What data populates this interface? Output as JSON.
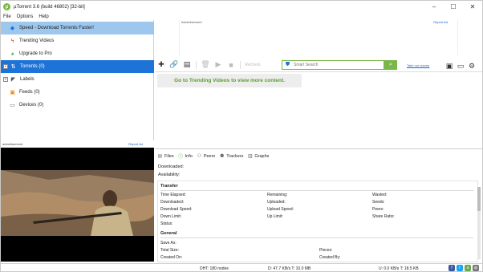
{
  "window": {
    "title": "µTorrent 3.6  (build 46802) [32-bit]",
    "controls": [
      "–",
      "☐",
      "✕"
    ]
  },
  "menu": [
    "File",
    "Options",
    "Help"
  ],
  "sidebar": {
    "items": [
      {
        "label": "Speed - Download Torrents Faster!",
        "icon": "shield-icon"
      },
      {
        "label": "Trending Videos",
        "icon": "lightning-icon"
      },
      {
        "label": "Upgrade to Pro",
        "icon": "upgrade-icon"
      },
      {
        "label": "Torrents (0)",
        "icon": "torrents-icon",
        "expander": "+"
      },
      {
        "label": "Labels",
        "icon": "label-icon",
        "expander": "+"
      },
      {
        "label": "Feeds (0)",
        "icon": "rss-icon"
      },
      {
        "label": "Devices (0)",
        "icon": "device-icon"
      }
    ]
  },
  "ads": {
    "top_label": "Advertisement",
    "report": "Report Ad",
    "side_label": "advertisement",
    "video_overlay": "⊕ ... ⊖"
  },
  "toolbar": {
    "search_placeholder": "Smart Search",
    "take_survey": "Take our survey",
    "ghost_button": "Recheck"
  },
  "banner": "Go to Trending Videos to view more content.",
  "tabs": [
    {
      "label": "Files",
      "icon": "files-icon"
    },
    {
      "label": "Info",
      "icon": "info-icon"
    },
    {
      "label": "Peers",
      "icon": "peers-icon"
    },
    {
      "label": "Trackers",
      "icon": "trackers-icon"
    },
    {
      "label": "Graphs",
      "icon": "graphs-icon"
    }
  ],
  "info": {
    "downloaded": "Downloaded:",
    "availability": "Availability:"
  },
  "transfer": {
    "title": "Transfer",
    "col1": [
      "Time Elapsed:",
      "Downloaded:",
      "Download Speed:",
      "Down Limit:",
      "Status:"
    ],
    "col2": [
      "Remaining:",
      "Uploaded:",
      "Upload Speed:",
      "Up Limit:"
    ],
    "col3": [
      "Wasted:",
      "Seeds:",
      "Peers:",
      "Share Ratio:"
    ]
  },
  "general": {
    "title": "General",
    "col1": [
      "Save As:",
      "Total Size:",
      "Created On:"
    ],
    "col2": [
      "Pieces:",
      "Created By:"
    ]
  },
  "status": {
    "dht": "DHT: 180 nodes",
    "down": "D: 47.7 KB/s T: 10.0 MB",
    "up": "U: 0.0 KB/s T: 18.5 KB"
  },
  "colors": {
    "selected": "#1e73d8",
    "speed_bg": "#9ec7ee",
    "accent_green": "#7ab648",
    "banner_text": "#5a9e2c"
  }
}
